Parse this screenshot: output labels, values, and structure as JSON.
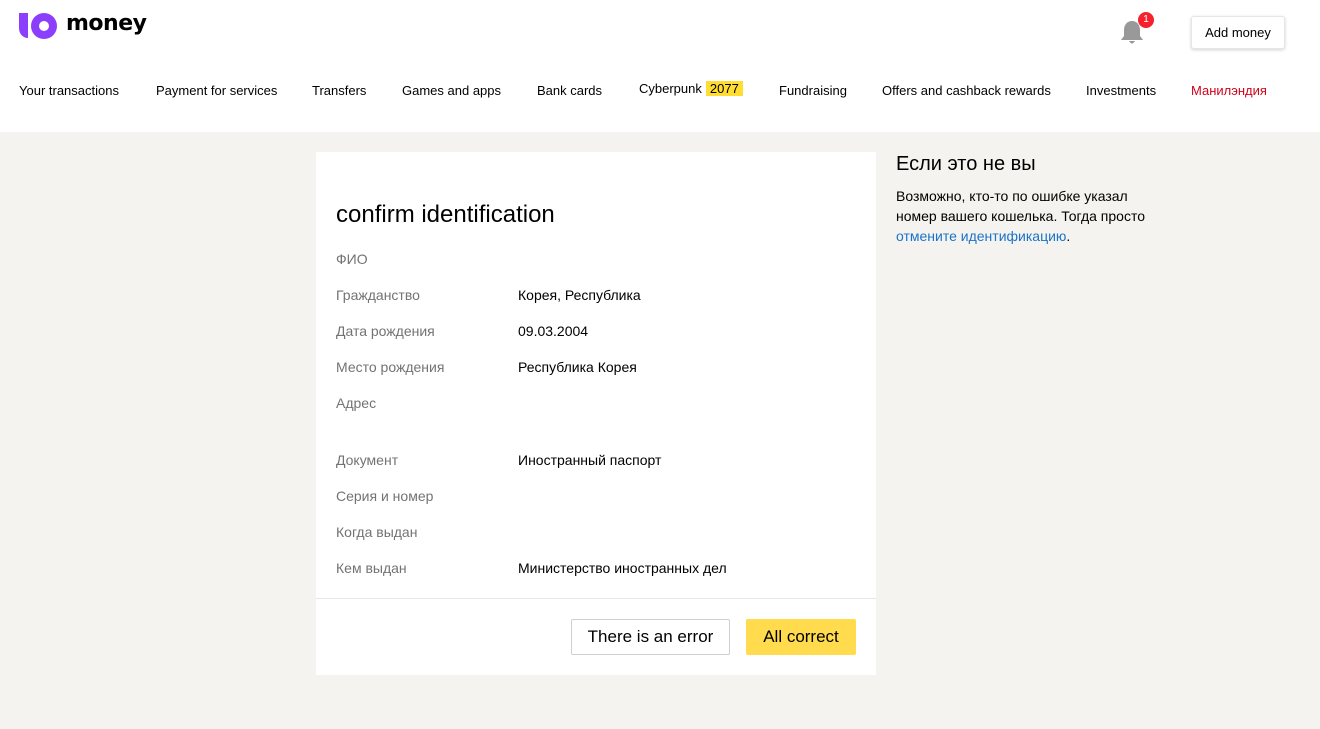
{
  "header": {
    "logo_text": "money",
    "notification_count": "1",
    "add_money_label": "Add money"
  },
  "nav": {
    "items": [
      {
        "label": "Your transactions"
      },
      {
        "label": "Payment for services"
      },
      {
        "label": "Transfers"
      },
      {
        "label": "Games and apps"
      },
      {
        "label": "Bank cards"
      },
      {
        "label": "Cyberpunk",
        "badge": "2077"
      },
      {
        "label": "Fundraising"
      },
      {
        "label": "Offers and cashback rewards"
      },
      {
        "label": "Investments"
      },
      {
        "label": "Манилэндия"
      }
    ]
  },
  "card": {
    "title": "confirm identification",
    "rows": [
      {
        "label": "ФИО",
        "value": ""
      },
      {
        "label": "Гражданство",
        "value": "Корея, Республика"
      },
      {
        "label": "Дата рождения",
        "value": "09.03.2004"
      },
      {
        "label": "Место рождения",
        "value": "Республика Корея"
      },
      {
        "label": "Адрес",
        "value": ""
      },
      {
        "label": "Документ",
        "value": "Иностранный паспорт"
      },
      {
        "label": "Серия и номер",
        "value": ""
      },
      {
        "label": "Когда выдан",
        "value": ""
      },
      {
        "label": "Кем выдан",
        "value": "Министерство иностранных дел"
      }
    ],
    "error_button": "There is an error",
    "ok_button": "All correct"
  },
  "side": {
    "title": "Если это не вы",
    "text": "Возможно, кто-то по ошибке указал номер вашего кошелька. Тогда просто ",
    "link": "отмените идентификацию",
    "text_end": "."
  },
  "colors": {
    "accent_yellow": "#ffdb4d",
    "logo_purple": "#8b3ffd",
    "link_blue": "#1a73c7",
    "nav_red": "#d0021b",
    "badge_red": "#f5222d",
    "page_bg": "#f4f3f0"
  }
}
